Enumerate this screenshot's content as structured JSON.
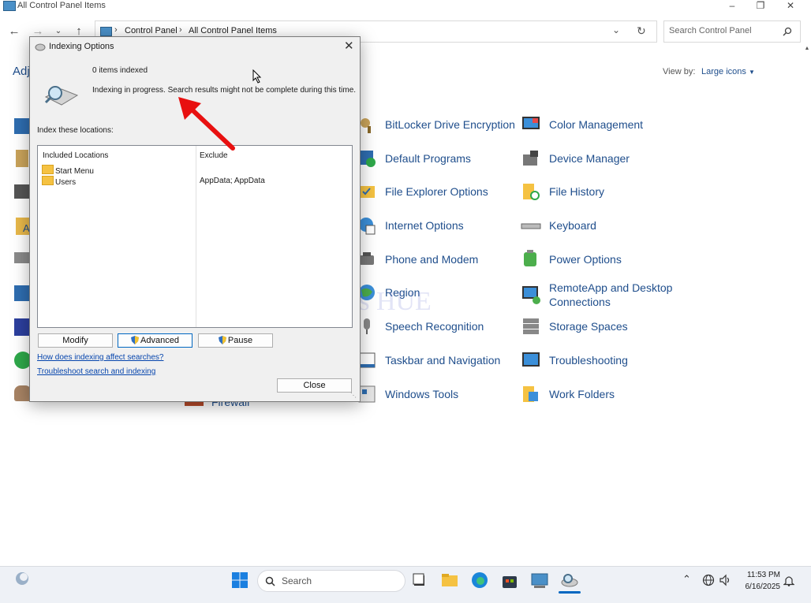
{
  "window": {
    "title": "All Control Panel Items"
  },
  "address": {
    "crumbs": [
      "Control Panel",
      "All Control Panel Items"
    ]
  },
  "search": {
    "placeholder": "Search Control Panel"
  },
  "view": {
    "label": "View by:",
    "value": "Large icons"
  },
  "partial_heading": "Adj",
  "partial_left_label": "A",
  "firewall_label": "Firewall",
  "items_col1": [
    "BitLocker Drive Encryption",
    "Default Programs",
    "File Explorer Options",
    "Internet Options",
    "Phone and Modem",
    "Region",
    "Speech Recognition",
    "Taskbar and Navigation",
    "Windows Tools"
  ],
  "items_col2": [
    "Color Management",
    "Device Manager",
    "File History",
    "Keyboard",
    "Power Options",
    "RemoteApp and Desktop Connections",
    "Storage Spaces",
    "Troubleshooting",
    "Work Folders"
  ],
  "watermark": "IT Pros HUE",
  "dialog": {
    "title": "Indexing Options",
    "items_indexed": "0 items indexed",
    "status": "Indexing in progress. Search results might not be complete during this time.",
    "locations_label": "Index these locations:",
    "columns": {
      "included": "Included Locations",
      "exclude": "Exclude"
    },
    "rows": [
      {
        "location": "Start Menu",
        "exclude": ""
      },
      {
        "location": "Users",
        "exclude": "AppData; AppData"
      }
    ],
    "buttons": {
      "modify": "Modify",
      "advanced": "Advanced",
      "pause": "Pause",
      "close": "Close"
    },
    "links": {
      "how": "How does indexing affect searches?",
      "troubleshoot": "Troubleshoot search and indexing"
    }
  },
  "taskbar": {
    "search_placeholder": "Search",
    "time": "11:53 PM",
    "date": "6/16/2025"
  },
  "colors": {
    "link": "#1f4e8c",
    "annotation_arrow": "#e81010",
    "accent": "#0067c0"
  }
}
